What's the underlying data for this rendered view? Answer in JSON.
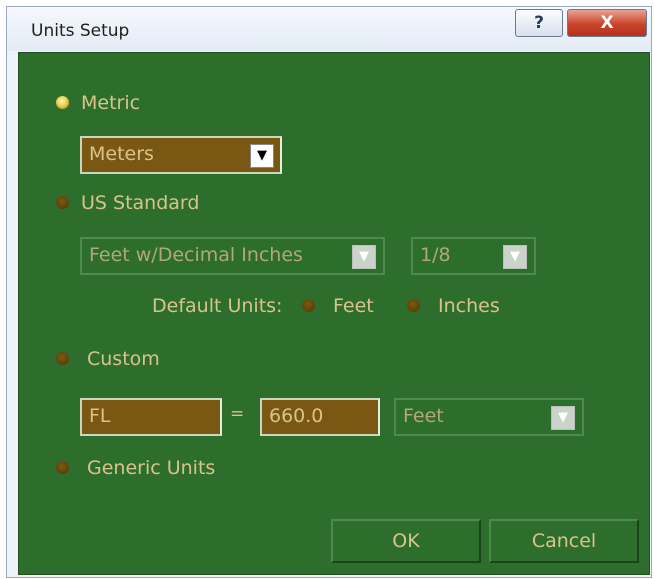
{
  "window": {
    "title": "Units Setup",
    "help_label": "?",
    "close_label": "X"
  },
  "colors": {
    "panel": "#2e6e2d",
    "text": "#d8c48a",
    "field": "#7a5814",
    "radio_selected": "#f0d658",
    "radio": "#6b4c0e"
  },
  "metric": {
    "label": "Metric",
    "selected": true,
    "unit_dropdown": {
      "value": "Meters"
    }
  },
  "us_standard": {
    "label": "US Standard",
    "selected": false,
    "format_dropdown": {
      "value": "Feet w/Decimal Inches"
    },
    "fraction_dropdown": {
      "value": "1/8"
    },
    "default_units_label": "Default Units:",
    "feet_label": "Feet",
    "inches_label": "Inches"
  },
  "custom": {
    "label": "Custom",
    "selected": false,
    "name_value": "FL",
    "equals": "=",
    "amount_value": "660.0",
    "unit_dropdown": {
      "value": "Feet"
    }
  },
  "generic": {
    "label": "Generic Units",
    "selected": false
  },
  "buttons": {
    "ok": "OK",
    "cancel": "Cancel"
  },
  "icons": {
    "dropdown": "chevron-down-icon",
    "help": "question-icon",
    "close": "close-icon"
  }
}
